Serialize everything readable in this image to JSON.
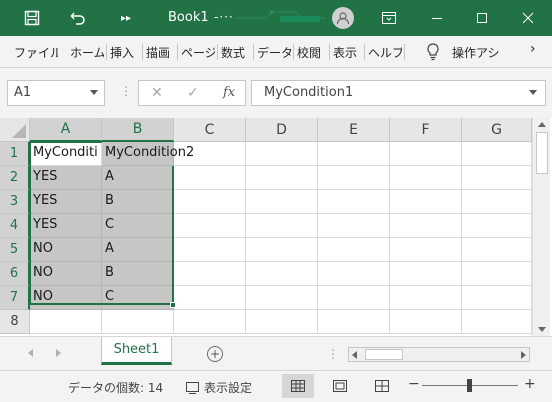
{
  "app": {
    "title": "Book1",
    "title_suffix": "-···"
  },
  "colors": {
    "accent": "#217346",
    "selection_fill": "#c6c6c6",
    "header_fill": "#e6e6e6"
  },
  "icons": {
    "save": "save-icon",
    "undo": "undo-icon",
    "more": "more-commands-icon",
    "account": "account-icon",
    "ribbon_display": "ribbon-display-options-icon",
    "minimize": "minimize-icon",
    "maximize": "maximize-icon",
    "close": "close-icon",
    "lightbulb": "lightbulb-icon"
  },
  "ribbon": {
    "tabs": [
      "ファイル",
      "ホーム",
      "挿入",
      "描画",
      "ページ",
      "数式",
      "データ",
      "校閲",
      "表示",
      "ヘルプ"
    ],
    "tell_me": "操作アシ",
    "more_arrow": "›"
  },
  "formula_bar": {
    "name_box": "A1",
    "dots": "⋮",
    "cancel": "✕",
    "enter": "✓",
    "fx": "fx",
    "value": "MyCondition1"
  },
  "grid": {
    "columns": [
      "A",
      "B",
      "C",
      "D",
      "E",
      "F",
      "G"
    ],
    "rows": [
      "1",
      "2",
      "3",
      "4",
      "5",
      "6",
      "7",
      "8"
    ],
    "cells": [
      [
        "MyConditi",
        "MyCondition2"
      ],
      [
        "YES",
        "A"
      ],
      [
        "YES",
        "B"
      ],
      [
        "YES",
        "C"
      ],
      [
        "NO",
        "A"
      ],
      [
        "NO",
        "B"
      ],
      [
        "NO",
        "C"
      ]
    ]
  },
  "sheets": {
    "tabs": [
      "Sheet1"
    ],
    "add": "+",
    "dots": "⋮"
  },
  "status": {
    "count_text": "データの個数: 14",
    "display_settings": "表示設定",
    "zoom_minus": "−",
    "zoom_plus": "+",
    "zoom_level_fraction": 0.5
  }
}
